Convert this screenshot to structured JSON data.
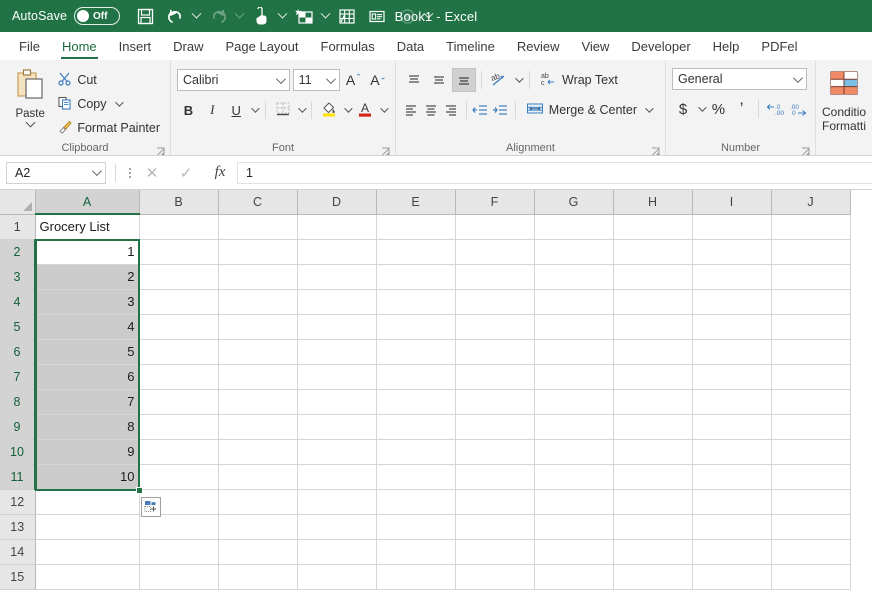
{
  "titlebar": {
    "autosave_label": "AutoSave",
    "autosave_state": "Off",
    "window_title": "Book1 - Excel",
    "quick_access": [
      {
        "name": "save-icon",
        "enabled": true
      },
      {
        "name": "undo-icon",
        "enabled": true
      },
      {
        "name": "redo-icon",
        "enabled": false
      },
      {
        "name": "touch-mode-icon",
        "enabled": true
      },
      {
        "name": "new-table-icon",
        "enabled": true
      },
      {
        "name": "table-icon",
        "enabled": true
      },
      {
        "name": "form-icon",
        "enabled": true
      },
      {
        "name": "record-icon",
        "enabled": false
      },
      {
        "name": "customize-qat-icon",
        "enabled": true
      }
    ]
  },
  "ribbon": {
    "tabs": [
      {
        "label": "File",
        "active": false
      },
      {
        "label": "Home",
        "active": true
      },
      {
        "label": "Insert",
        "active": false
      },
      {
        "label": "Draw",
        "active": false
      },
      {
        "label": "Page Layout",
        "active": false
      },
      {
        "label": "Formulas",
        "active": false
      },
      {
        "label": "Data",
        "active": false
      },
      {
        "label": "Timeline",
        "active": false
      },
      {
        "label": "Review",
        "active": false
      },
      {
        "label": "View",
        "active": false
      },
      {
        "label": "Developer",
        "active": false
      },
      {
        "label": "Help",
        "active": false
      },
      {
        "label": "PDFel",
        "active": false
      }
    ],
    "clipboard": {
      "group_label": "Clipboard",
      "paste_label": "Paste",
      "cut_label": "Cut",
      "copy_label": "Copy",
      "format_painter_label": "Format Painter"
    },
    "font": {
      "group_label": "Font",
      "font_name": "Calibri",
      "font_size": "11",
      "bold_label": "B",
      "italic_label": "I",
      "underline_label": "U",
      "grow_font_label": "A",
      "shrink_font_label": "A"
    },
    "alignment": {
      "group_label": "Alignment",
      "wrap_text_label": "Wrap Text",
      "merge_center_label": "Merge & Center"
    },
    "number": {
      "group_label": "Number",
      "format": "General",
      "currency_label": "$",
      "percent_label": "%",
      "comma_label": "’"
    },
    "styles": {
      "conditional_formatting_line1": "Conditio",
      "conditional_formatting_line2": "Formatti"
    }
  },
  "formula_bar": {
    "name_box": "A2",
    "formula_value": "1",
    "cancel_icon": "✕",
    "enter_icon": "✓",
    "function_icon": "fx"
  },
  "sheet": {
    "column_headers": [
      "A",
      "B",
      "C",
      "D",
      "E",
      "F",
      "G",
      "H",
      "I",
      "J"
    ],
    "selected_columns": [
      "A"
    ],
    "row_headers": [
      "1",
      "2",
      "3",
      "4",
      "5",
      "6",
      "7",
      "8",
      "9",
      "10",
      "11",
      "12",
      "13",
      "14",
      "15"
    ],
    "selected_rows": [
      "2",
      "3",
      "4",
      "5",
      "6",
      "7",
      "8",
      "9",
      "10",
      "11"
    ],
    "active_cell": "A2",
    "selection_range": "A2:A11",
    "rows": [
      {
        "row": "1",
        "A": "Grocery List",
        "align": "left",
        "state": "normal"
      },
      {
        "row": "2",
        "A": "1",
        "align": "right",
        "state": "active"
      },
      {
        "row": "3",
        "A": "2",
        "align": "right",
        "state": "selected"
      },
      {
        "row": "4",
        "A": "3",
        "align": "right",
        "state": "selected"
      },
      {
        "row": "5",
        "A": "4",
        "align": "right",
        "state": "selected"
      },
      {
        "row": "6",
        "A": "5",
        "align": "right",
        "state": "selected"
      },
      {
        "row": "7",
        "A": "6",
        "align": "right",
        "state": "selected"
      },
      {
        "row": "8",
        "A": "7",
        "align": "right",
        "state": "selected"
      },
      {
        "row": "9",
        "A": "8",
        "align": "right",
        "state": "selected"
      },
      {
        "row": "10",
        "A": "9",
        "align": "right",
        "state": "selected"
      },
      {
        "row": "11",
        "A": "10",
        "align": "right",
        "state": "selected"
      },
      {
        "row": "12",
        "A": "",
        "align": "left",
        "state": "normal"
      },
      {
        "row": "13",
        "A": "",
        "align": "left",
        "state": "normal"
      },
      {
        "row": "14",
        "A": "",
        "align": "left",
        "state": "normal"
      },
      {
        "row": "15",
        "A": "",
        "align": "left",
        "state": "normal"
      }
    ],
    "autofill_options_icon": "autofill-options-icon"
  },
  "colors": {
    "excel_green": "#217346",
    "selection_gray": "#cbcbcb",
    "ribbon_bg": "#f3f3f3",
    "header_bg": "#e6e6e6"
  }
}
